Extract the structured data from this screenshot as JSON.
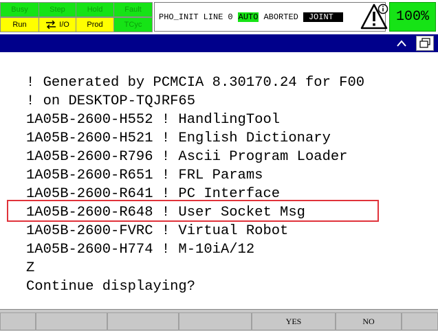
{
  "status": {
    "busy": "Busy",
    "step": "Step",
    "hold": "Hold",
    "fault": "Fault",
    "run": "Run",
    "io": "I/O",
    "prod": "Prod",
    "tcyc": "TCyc"
  },
  "line_status": {
    "program": "PHO_INIT",
    "line_label": "LINE",
    "line_number": "0",
    "mode": "AUTO",
    "state": "ABORTED",
    "coord": "JOINT"
  },
  "override": "100%",
  "title_bar": {
    "up_icon": "caret-up-icon",
    "window_icon": "window-toggle-icon"
  },
  "content": {
    "lines": [
      "! Generated by PCMCIA 8.30170.24 for F00",
      "! on DESKTOP-TQJRF65",
      "1A05B-2600-H552 ! HandlingTool",
      "1A05B-2600-H521 ! English Dictionary",
      "1A05B-2600-R796 ! Ascii Program Loader",
      "1A05B-2600-R651 ! FRL Params",
      "1A05B-2600-R641 ! PC Interface",
      "1A05B-2600-R648 ! User Socket Msg",
      "1A05B-2600-FVRC ! Virtual Robot",
      "1A05B-2600-H774 ! M-10iA/12",
      "Z",
      "Continue displaying?"
    ],
    "highlight_color": "#e0323a"
  },
  "function_keys": [
    "",
    "",
    "",
    "",
    "YES",
    "NO"
  ],
  "colors": {
    "status_green": "#16e316",
    "status_yellow": "#ffff00",
    "title_bar": "#00008b"
  }
}
